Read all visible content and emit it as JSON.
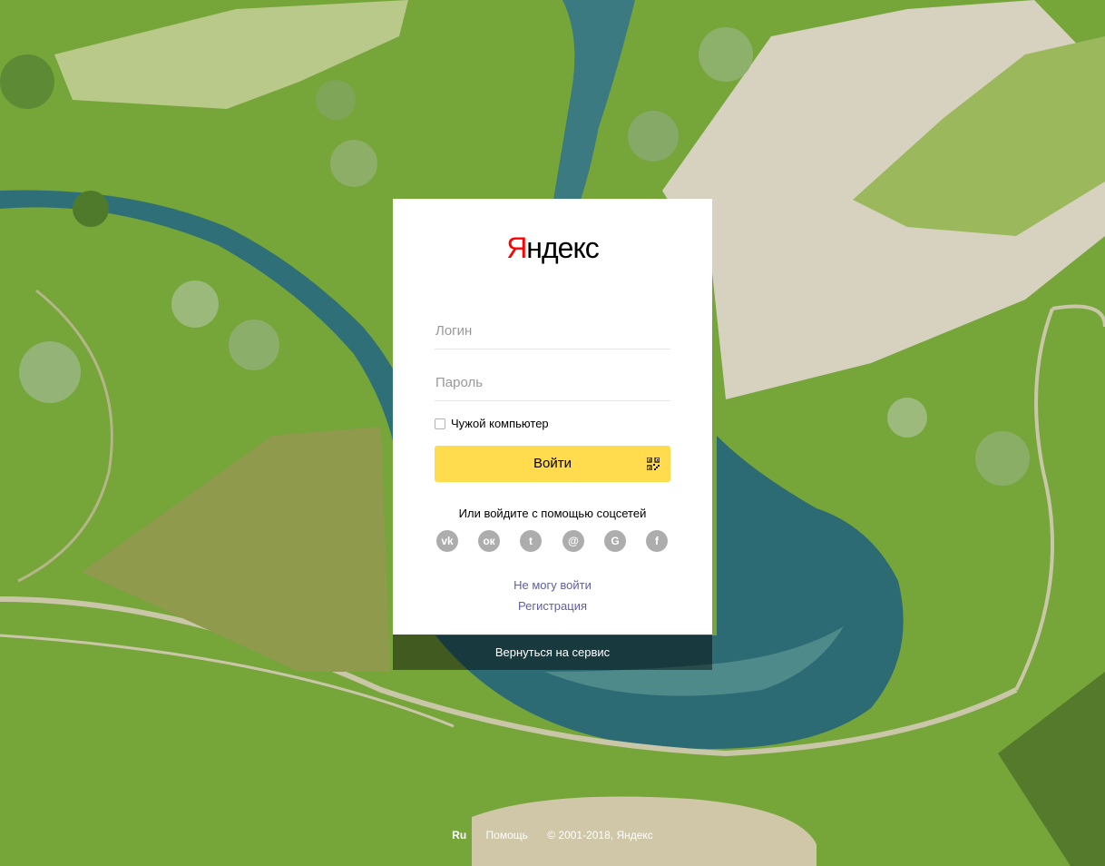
{
  "logo": {
    "first_letter": "Я",
    "rest": "ндекс"
  },
  "login_form": {
    "login_placeholder": "Логин",
    "password_placeholder": "Пароль",
    "remember_label": "Чужой компьютер",
    "submit_label": "Войти"
  },
  "social": {
    "title": "Или войдите с помощью соцсетей",
    "providers": [
      {
        "name": "vk",
        "glyph": "vk"
      },
      {
        "name": "odnoklassniki",
        "glyph": "ок"
      },
      {
        "name": "twitter",
        "glyph": "t"
      },
      {
        "name": "mail",
        "glyph": "@"
      },
      {
        "name": "google",
        "glyph": "G"
      },
      {
        "name": "facebook",
        "glyph": "f"
      }
    ]
  },
  "links": {
    "cant_login": "Не могу войти",
    "register": "Регистрация"
  },
  "back_to_service": "Вернуться на сервис",
  "footer": {
    "lang": "Ru",
    "help": "Помощь",
    "copyright": "© 2001-2018, Яндекс"
  },
  "colors": {
    "submit": "#ffdb4d",
    "logo_accent": "#ff0000",
    "link": "#5f5f9e"
  }
}
